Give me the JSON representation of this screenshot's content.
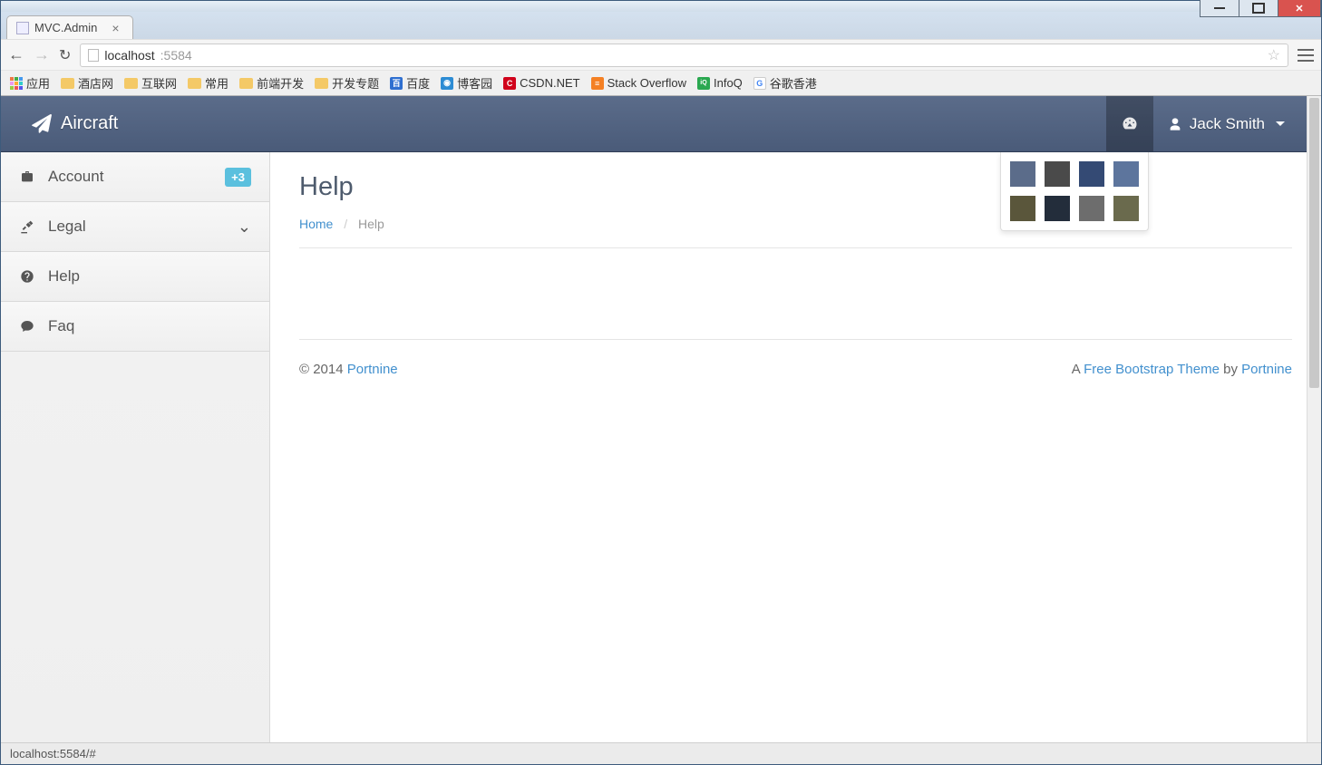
{
  "os": {
    "window": "minimize/maximize/close"
  },
  "browser": {
    "tab_title": "MVC.Admin",
    "url_host": "localhost",
    "url_port": ":5584",
    "bookmarks": [
      {
        "label": "应用",
        "icon": "grid"
      },
      {
        "label": "酒店网",
        "icon": "folder"
      },
      {
        "label": "互联网",
        "icon": "folder"
      },
      {
        "label": "常用",
        "icon": "folder"
      },
      {
        "label": "前端开发",
        "icon": "folder"
      },
      {
        "label": "开发专题",
        "icon": "folder"
      },
      {
        "label": "百度",
        "icon": "baidu"
      },
      {
        "label": "博客园",
        "icon": "cnblogs"
      },
      {
        "label": "CSDN.NET",
        "icon": "csdn"
      },
      {
        "label": "Stack Overflow",
        "icon": "so"
      },
      {
        "label": "InfoQ",
        "icon": "infoq"
      },
      {
        "label": "谷歌香港",
        "icon": "google"
      }
    ],
    "status_text": "localhost:5584/#"
  },
  "navbar": {
    "brand": "Aircraft",
    "user_name": "Jack Smith"
  },
  "theme_colors": [
    "#5b6c8a",
    "#4a4a4a",
    "#344a74",
    "#5d759d",
    "#5a563b",
    "#232d3b",
    "#6d6d6d",
    "#6a6a4d"
  ],
  "sidebar": {
    "items": [
      {
        "label": "Account",
        "icon": "briefcase",
        "badge": "+3"
      },
      {
        "label": "Legal",
        "icon": "gavel",
        "chevron": true
      },
      {
        "label": "Help",
        "icon": "question"
      },
      {
        "label": "Faq",
        "icon": "comment"
      }
    ]
  },
  "page": {
    "title": "Help",
    "breadcrumb_home": "Home",
    "breadcrumb_current": "Help"
  },
  "footer": {
    "left_prefix": "© 2014 ",
    "left_link": "Portnine",
    "right_prefix": "A ",
    "right_link1": "Free Bootstrap Theme",
    "right_mid": " by ",
    "right_link2": "Portnine"
  }
}
